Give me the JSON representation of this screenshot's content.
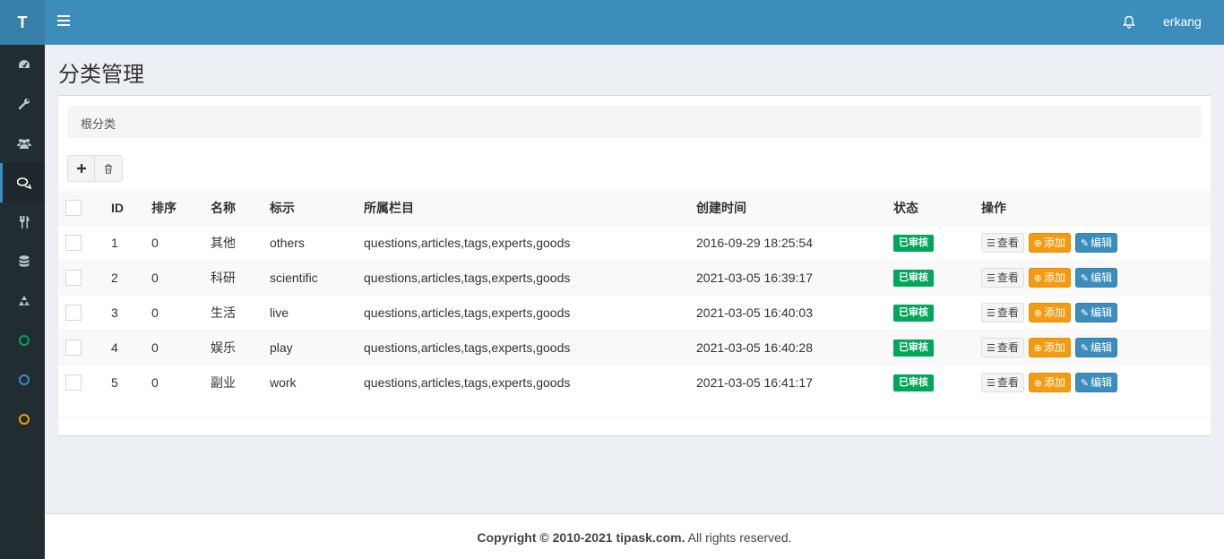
{
  "logo": "T",
  "sidebar": {
    "items": [
      {
        "icon": "dashboard-icon"
      },
      {
        "icon": "wrench-icon"
      },
      {
        "icon": "users-icon"
      },
      {
        "icon": "comments-icon",
        "active": true
      },
      {
        "icon": "cutlery-icon"
      },
      {
        "icon": "database-icon"
      },
      {
        "icon": "recycle-icon"
      },
      {
        "icon": "circle-green-icon",
        "color": "#00a65a"
      },
      {
        "icon": "circle-blue-icon",
        "color": "#3c8dbc"
      },
      {
        "icon": "circle-orange-icon",
        "color": "#f39c12"
      }
    ]
  },
  "header": {
    "user": "erkang"
  },
  "page": {
    "title": "分类管理"
  },
  "breadcrumb": "根分类",
  "table": {
    "headers": [
      "ID",
      "排序",
      "名称",
      "标示",
      "所属栏目",
      "创建时间",
      "状态",
      "操作"
    ],
    "rows": [
      {
        "id": "1",
        "sort": "0",
        "name": "其他",
        "slug": "others",
        "section": "questions,articles,tags,experts,goods",
        "created": "2016-09-29 18:25:54",
        "status": "已审核"
      },
      {
        "id": "2",
        "sort": "0",
        "name": "科研",
        "slug": "scientific",
        "section": "questions,articles,tags,experts,goods",
        "created": "2021-03-05 16:39:17",
        "status": "已审核"
      },
      {
        "id": "3",
        "sort": "0",
        "name": "生活",
        "slug": "live",
        "section": "questions,articles,tags,experts,goods",
        "created": "2021-03-05 16:40:03",
        "status": "已审核"
      },
      {
        "id": "4",
        "sort": "0",
        "name": "娱乐",
        "slug": "play",
        "section": "questions,articles,tags,experts,goods",
        "created": "2021-03-05 16:40:28",
        "status": "已审核"
      },
      {
        "id": "5",
        "sort": "0",
        "name": "副业",
        "slug": "work",
        "section": "questions,articles,tags,experts,goods",
        "created": "2021-03-05 16:41:17",
        "status": "已审核"
      }
    ],
    "actions": {
      "view": "查看",
      "add": "添加",
      "edit": "编辑"
    }
  },
  "footer": {
    "copyright": "Copyright © 2010-2021 tipask.com.",
    "rights": " All rights reserved."
  },
  "colors": {
    "header": "#3c8dbc",
    "sidebar": "#222d32",
    "success": "#00a65a",
    "warning": "#f39c12"
  }
}
